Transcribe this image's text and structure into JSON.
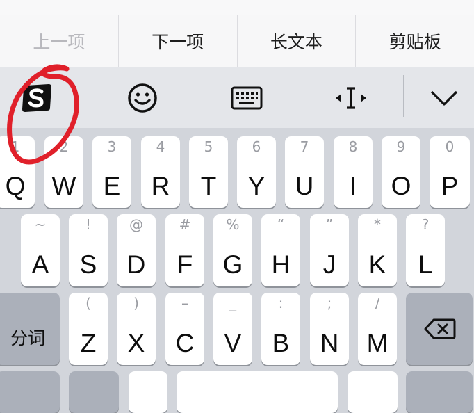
{
  "nav": {
    "prev": "上一项",
    "next": "下一项",
    "long_text": "长文本",
    "clipboard": "剪贴板"
  },
  "toolbar": {
    "icons": [
      "sogou-logo-icon",
      "emoji-icon",
      "keyboard-icon",
      "cursor-move-icon",
      "chevron-down-icon"
    ]
  },
  "keyboard": {
    "row1": [
      {
        "alt": "1",
        "key": "Q"
      },
      {
        "alt": "2",
        "key": "W"
      },
      {
        "alt": "3",
        "key": "E"
      },
      {
        "alt": "4",
        "key": "R"
      },
      {
        "alt": "5",
        "key": "T"
      },
      {
        "alt": "6",
        "key": "Y"
      },
      {
        "alt": "7",
        "key": "U"
      },
      {
        "alt": "8",
        "key": "I"
      },
      {
        "alt": "9",
        "key": "O"
      },
      {
        "alt": "0",
        "key": "P"
      }
    ],
    "row2": [
      {
        "alt": "~",
        "key": "A"
      },
      {
        "alt": "!",
        "key": "S"
      },
      {
        "alt": "@",
        "key": "D"
      },
      {
        "alt": "#",
        "key": "F"
      },
      {
        "alt": "%",
        "key": "G"
      },
      {
        "alt": "“",
        "key": "H"
      },
      {
        "alt": "”",
        "key": "J"
      },
      {
        "alt": "*",
        "key": "K"
      },
      {
        "alt": "?",
        "key": "L"
      }
    ],
    "row3": [
      {
        "alt": "(",
        "key": "Z"
      },
      {
        "alt": ")",
        "key": "X"
      },
      {
        "alt": "–",
        "key": "C"
      },
      {
        "alt": "_",
        "key": "V"
      },
      {
        "alt": ":",
        "key": "B"
      },
      {
        "alt": ";",
        "key": "N"
      },
      {
        "alt": "/",
        "key": "M"
      }
    ],
    "segment_label": "分词"
  },
  "colors": {
    "keyboard_bg": "#d2d5db",
    "key_bg": "#ffffff",
    "function_key_bg": "#abb0ba",
    "annotation_red": "#e0202a"
  }
}
